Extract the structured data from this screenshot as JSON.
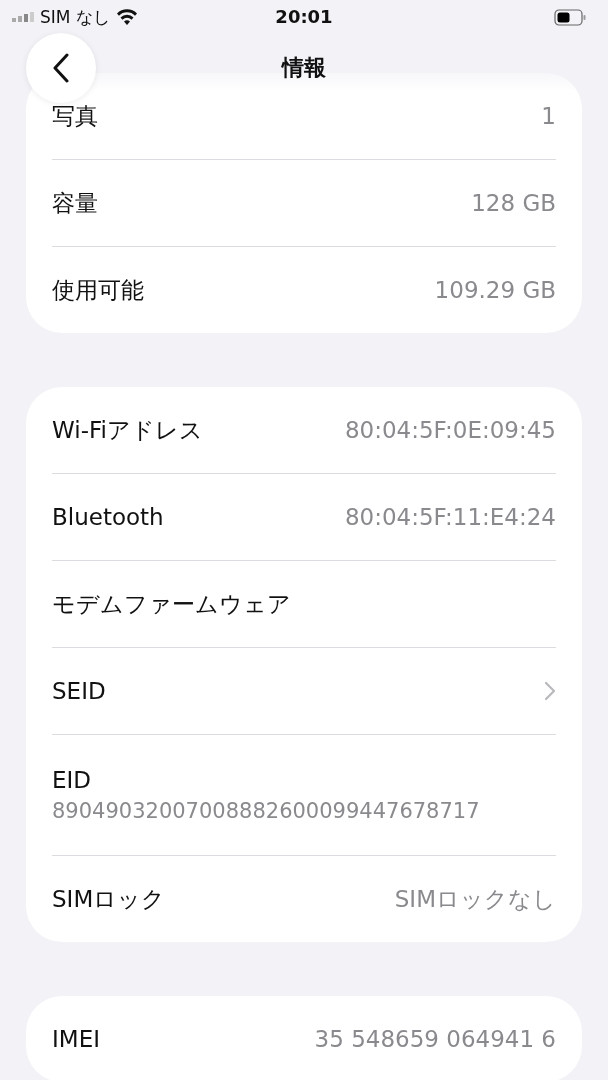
{
  "status_bar": {
    "carrier": "SIM なし",
    "time": "20:01"
  },
  "nav": {
    "title": "情報"
  },
  "sections": [
    {
      "rows": [
        {
          "kind": "value",
          "label": "写真",
          "value": "1"
        },
        {
          "kind": "value",
          "label": "容量",
          "value": "128 GB"
        },
        {
          "kind": "value",
          "label": "使用可能",
          "value": "109.29 GB"
        }
      ]
    },
    {
      "rows": [
        {
          "kind": "value",
          "label": "Wi-Fiアドレス",
          "value": "80:04:5F:0E:09:45"
        },
        {
          "kind": "value",
          "label": "Bluetooth",
          "value": "80:04:5F:11:E4:24"
        },
        {
          "kind": "plain",
          "label": "モデムファームウェア"
        },
        {
          "kind": "link",
          "label": "SEID"
        },
        {
          "kind": "stacked",
          "label": "EID",
          "value": "89049032007008882600099447678717"
        },
        {
          "kind": "value",
          "label": "SIMロック",
          "value": "SIMロックなし"
        }
      ]
    },
    {
      "rows": [
        {
          "kind": "value",
          "label": "IMEI",
          "value": "35 548659 064941 6"
        }
      ]
    }
  ]
}
